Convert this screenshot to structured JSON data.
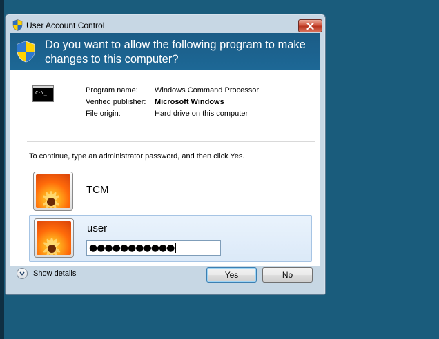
{
  "window": {
    "title": "User Account Control",
    "close_icon": "close-icon"
  },
  "header": {
    "question": "Do you want to allow the following program to make changes to this computer?",
    "shield_icon": "uac-shield-icon"
  },
  "program": {
    "icon": "command-prompt-icon",
    "icon_text": "C:\\_",
    "name_label": "Program name:",
    "name_value": "Windows Command Processor",
    "publisher_label": "Verified publisher:",
    "publisher_value": "Microsoft Windows",
    "origin_label": "File origin:",
    "origin_value": "Hard drive on this computer"
  },
  "instruction": "To continue, type an administrator password, and then click Yes.",
  "accounts": [
    {
      "name": "TCM",
      "selected": false
    },
    {
      "name": "user",
      "selected": true,
      "password_masked": "●●●●●●●●●●●"
    }
  ],
  "footer": {
    "details_label": "Show details",
    "yes_label": "Yes",
    "no_label": "No"
  },
  "colors": {
    "desktop": "#1a5c7c",
    "header_banner": "#1d6896",
    "selection": "#dbe9f8"
  }
}
